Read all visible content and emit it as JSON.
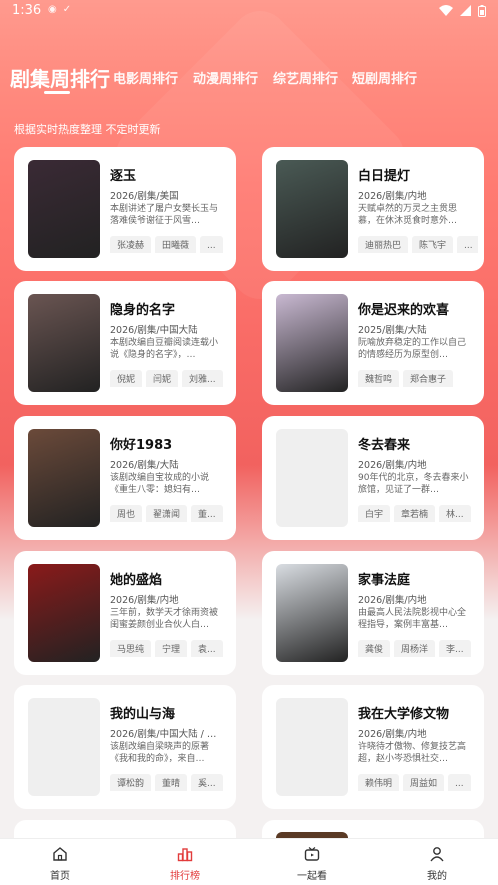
{
  "status": {
    "time": "1:36"
  },
  "tabs": [
    {
      "label": "剧集周排行"
    },
    {
      "label": "电影周排行"
    },
    {
      "label": "动漫周排行"
    },
    {
      "label": "综艺周排行"
    },
    {
      "label": "短剧周排行"
    }
  ],
  "subtitle": "根据实时热度整理 不定时更新",
  "cards": [
    {
      "title": "逐玉",
      "meta": "2026/剧集/美国",
      "desc": "本剧讲述了屠户女樊长玉与落难侯爷谢征于风雪…",
      "tags": [
        "张凌赫",
        "田曦薇",
        "..."
      ],
      "cover_color": "#3a2a35"
    },
    {
      "title": "白日提灯",
      "meta": "2026/剧集/内地",
      "desc": "天赋卓然的万灵之主贯思慕，在休沐觅食时意外…",
      "tags": [
        "迪丽热巴",
        "陈飞宇",
        "..."
      ],
      "cover_color": "#4a5a55"
    },
    {
      "title": "隐身的名字",
      "meta": "2026/剧集/中国大陆",
      "desc": "本剧改编自豆瓣阅读连载小说《隐身的名字》，…",
      "tags": [
        "倪妮",
        "闫妮",
        "刘雅..."
      ],
      "cover_color": "#6a5552"
    },
    {
      "title": "你是迟来的欢喜",
      "meta": "2025/剧集/大陆",
      "desc": "阮喻放弃稳定的工作以自己的情感经历为原型创…",
      "tags": [
        "魏哲鸣",
        "郑合惠子"
      ],
      "cover_color": "#c9b9d2"
    },
    {
      "title": "你好1983",
      "meta": "2026/剧集/大陆",
      "desc": " 该剧改编自宝妆成的小说《重生八零：媳妇有…",
      "tags": [
        "周也",
        "翟潇闻",
        "董..."
      ],
      "cover_color": "#6b4a3a"
    },
    {
      "title": "冬去春来",
      "meta": "2026/剧集/内地",
      "desc": "90年代的北京，冬去春来小旅馆，见证了一群…",
      "tags": [
        "白宇",
        "章若楠",
        "林..."
      ],
      "cover_color": "#efefef"
    },
    {
      "title": "她的盛焰",
      "meta": "2026/剧集/内地",
      "desc": "三年前，数学天才徐雨资被闺蜜姜颜创业合伙人白…",
      "tags": [
        "马思纯",
        "宁理",
        "袁..."
      ],
      "cover_color": "#8a1a1a"
    },
    {
      "title": "家事法庭",
      "meta": "2026/剧集/内地",
      "desc": "由最高人民法院影视中心全程指导，案例丰富基…",
      "tags": [
        "龚俊",
        "周杨洋",
        "李..."
      ],
      "cover_color": "#d9dde2"
    },
    {
      "title": "我的山与海",
      "meta": "2026/剧集/中国大陆 / …",
      "desc": "该剧改编自梁晓声的原著《我和我的命》，来自…",
      "tags": [
        "谭松韵",
        "董晴",
        "奚..."
      ],
      "cover_color": "#efefef"
    },
    {
      "title": "我在大学修文物",
      "meta": "2026/剧集/内地",
      "desc": "许晓待才傲物、修复技艺高超，赵小岑恐惧社交…",
      "tags": [
        "赖伟明",
        "周益如",
        "..."
      ],
      "cover_color": "#efefef"
    }
  ],
  "nav": [
    {
      "label": "首页",
      "icon": "home-icon"
    },
    {
      "label": "排行榜",
      "icon": "ranking-icon"
    },
    {
      "label": "一起看",
      "icon": "tv-icon"
    },
    {
      "label": "我的",
      "icon": "user-icon"
    }
  ],
  "colors": {
    "accent": "#e23b3b",
    "hero_top": "#ff9a8e",
    "hero_mid": "#f96b66"
  }
}
